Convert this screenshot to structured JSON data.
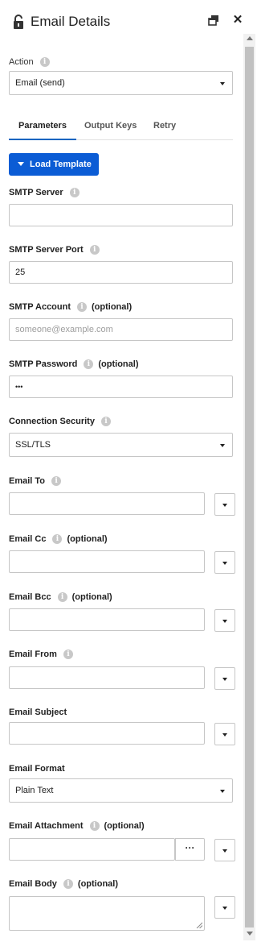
{
  "header": {
    "title": "Email Details"
  },
  "action": {
    "label": "Action",
    "value": "Email (send)"
  },
  "tabs": [
    {
      "label": "Parameters"
    },
    {
      "label": "Output Keys"
    },
    {
      "label": "Retry"
    }
  ],
  "load_template_label": "Load Template",
  "optional_text": "(optional)",
  "fields": {
    "smtp_server": {
      "label": "SMTP Server",
      "value": ""
    },
    "smtp_port": {
      "label": "SMTP Server Port",
      "value": "25"
    },
    "smtp_account": {
      "label": "SMTP Account",
      "placeholder": "someone@example.com"
    },
    "smtp_password": {
      "label": "SMTP Password",
      "value": "•••"
    },
    "connection_security": {
      "label": "Connection Security",
      "value": "SSL/TLS"
    },
    "email_to": {
      "label": "Email To",
      "value": ""
    },
    "email_cc": {
      "label": "Email Cc",
      "value": ""
    },
    "email_bcc": {
      "label": "Email Bcc",
      "value": ""
    },
    "email_from": {
      "label": "Email From",
      "value": ""
    },
    "email_subject": {
      "label": "Email Subject",
      "value": ""
    },
    "email_format": {
      "label": "Email Format",
      "value": "Plain Text"
    },
    "email_attachment": {
      "label": "Email Attachment",
      "value": "",
      "browse_label": "···"
    },
    "email_body": {
      "label": "Email Body",
      "value": ""
    }
  },
  "colors": {
    "accent": "#0b5cd5",
    "tab_underline": "#1565c0",
    "border": "#c6c6c6"
  }
}
